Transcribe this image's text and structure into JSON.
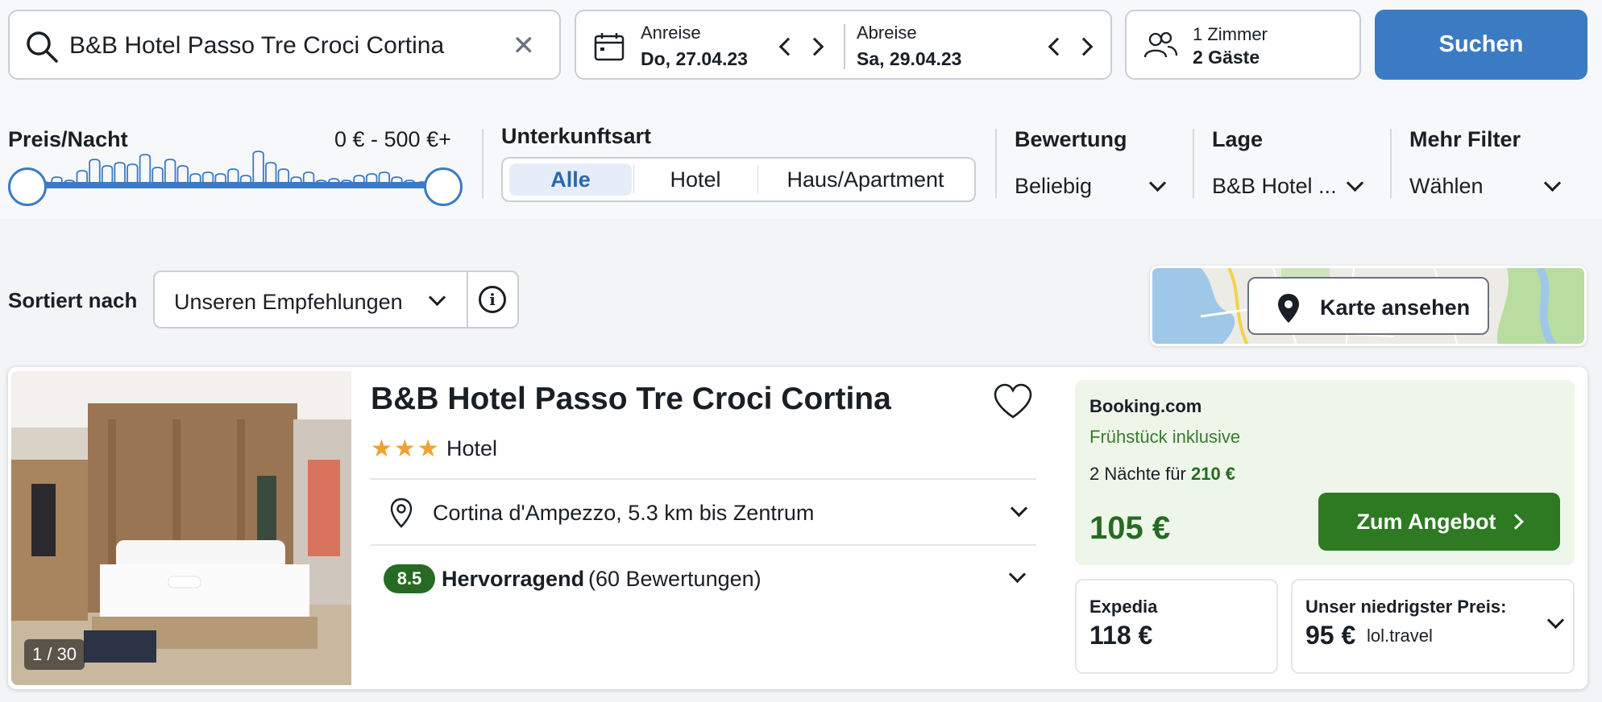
{
  "search": {
    "query": "B&B Hotel Passo Tre Croci Cortina",
    "icon": "search-icon",
    "clear_icon": "close-icon",
    "clear_glyph": "✕"
  },
  "dates": {
    "checkin_label": "Anreise",
    "checkin_value": "Do, 27.04.23",
    "checkout_label": "Abreise",
    "checkout_value": "Sa, 29.04.23"
  },
  "guests": {
    "rooms": "1 Zimmer",
    "guests": "2 Gäste"
  },
  "search_button": "Suchen",
  "filters": {
    "price_label": "Preis/Nacht",
    "price_range": "0 € - 500 €+",
    "accommodation_label": "Unterkunftsart",
    "accommodation_options": [
      "Alle",
      "Hotel",
      "Haus/Apartment"
    ],
    "accommodation_selected": "Alle",
    "rating_label": "Bewertung",
    "rating_value": "Beliebig",
    "location_label": "Lage",
    "location_value": "B&B Hotel ...",
    "more_label": "Mehr Filter",
    "more_value": "Wählen"
  },
  "sort": {
    "label": "Sortiert nach",
    "value": "Unseren Empfehlungen",
    "info_glyph": "i"
  },
  "map": {
    "button_label": "Karte ansehen"
  },
  "result": {
    "photo_counter": "1 / 30",
    "name": "B&B Hotel Passo Tre Croci Cortina",
    "stars": "★★★",
    "star_count": 3,
    "type": "Hotel",
    "location": "Cortina d'Ampezzo, 5.3 km bis Zentrum",
    "rating_score": "8.5",
    "rating_word": "Hervorragend",
    "rating_count": "(60 Bewertungen)",
    "offer": {
      "provider": "Booking.com",
      "breakfast": "Frühstück inklusive",
      "nights_text": "2 Nächte für",
      "nights_total": "210 €",
      "price": "105 €",
      "button_label": "Zum Angebot"
    },
    "alt_offer": {
      "provider": "Expedia",
      "price": "118 €"
    },
    "lowest": {
      "label": "Unser niedrigster Preis:",
      "price": "95 €",
      "source": "lol.travel"
    }
  },
  "colors": {
    "accent": "#3b7bc4",
    "deal_green": "#2d7a22",
    "rating_green": "#266a23",
    "star": "#f0a134"
  }
}
